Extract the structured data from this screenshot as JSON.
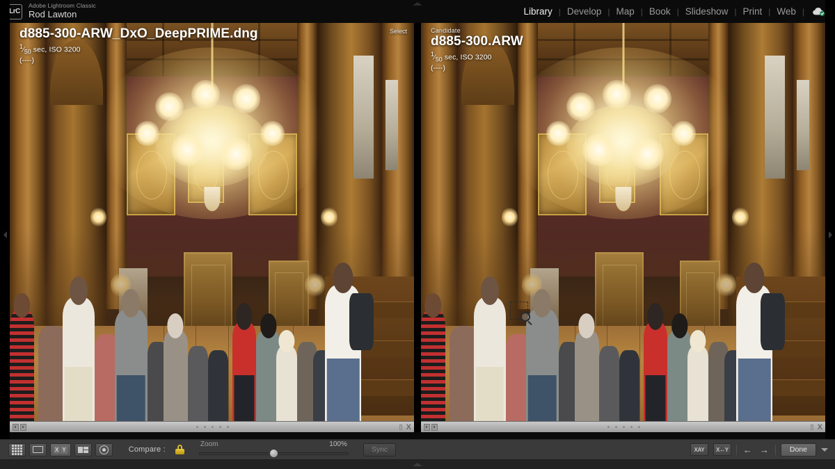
{
  "app": {
    "logo_text": "LrC",
    "product": "Adobe Lightroom Classic",
    "user": "Rod Lawton"
  },
  "modules": {
    "items": [
      {
        "label": "Library",
        "active": true
      },
      {
        "label": "Develop",
        "active": false
      },
      {
        "label": "Map",
        "active": false
      },
      {
        "label": "Book",
        "active": false
      },
      {
        "label": "Slideshow",
        "active": false
      },
      {
        "label": "Print",
        "active": false
      },
      {
        "label": "Web",
        "active": false
      }
    ],
    "separator": "|",
    "sync_icon": "cloud-check-icon"
  },
  "compare": {
    "select": {
      "tag": "Select",
      "filename": "d885-300-ARW_DxO_DeepPRIME.dng",
      "exif_shutter": "1",
      "exif_shutter_denom": "50",
      "exif_rest": " sec, ISO 3200",
      "exif_extra": "(----)"
    },
    "candidate": {
      "tag": "Candidate",
      "filename": "d885-300.ARW",
      "exif_shutter": "1",
      "exif_shutter_denom": "50",
      "exif_rest": " sec, ISO 3200",
      "exif_extra": "(----)"
    },
    "cursor": "loupe-magnifier-cursor"
  },
  "photo": {
    "subject": "ornate wood-panelled hall with chandelier and crowd of visitors",
    "colors": {
      "wall": "#5a2b28",
      "wood": "#a5742f",
      "gold": "#c9a253",
      "floor": "#b5853f",
      "light": "#fff1be"
    }
  },
  "strip": {
    "reject_label": "X",
    "star_count": 5
  },
  "toolbar": {
    "view_buttons": [
      {
        "name": "grid-view-button",
        "icon": "grid-icon"
      },
      {
        "name": "loupe-view-button",
        "icon": "loupe-icon"
      },
      {
        "name": "compare-view-button",
        "icon": "xy-icon",
        "x": "X",
        "y": "Y"
      },
      {
        "name": "survey-view-button",
        "icon": "survey-icon"
      },
      {
        "name": "people-view-button",
        "icon": "face-icon"
      }
    ],
    "compare_label": "Compare :",
    "lock_icon": "lock-closed-icon",
    "zoom_label": "Zoom",
    "zoom_value": "100%",
    "zoom_percent": 50,
    "sync_label": "Sync",
    "swap_label": "XAY",
    "make_select_label": "X↔Y",
    "prev_arrow": "←",
    "next_arrow": "→",
    "done_label": "Done",
    "dropdown_icon": "chevron-down-icon"
  },
  "panels": {
    "top_toggle": "top-panel-toggle",
    "left_toggle": "left-panel-toggle",
    "right_toggle": "right-panel-toggle",
    "filmstrip_toggle": "filmstrip-toggle"
  }
}
